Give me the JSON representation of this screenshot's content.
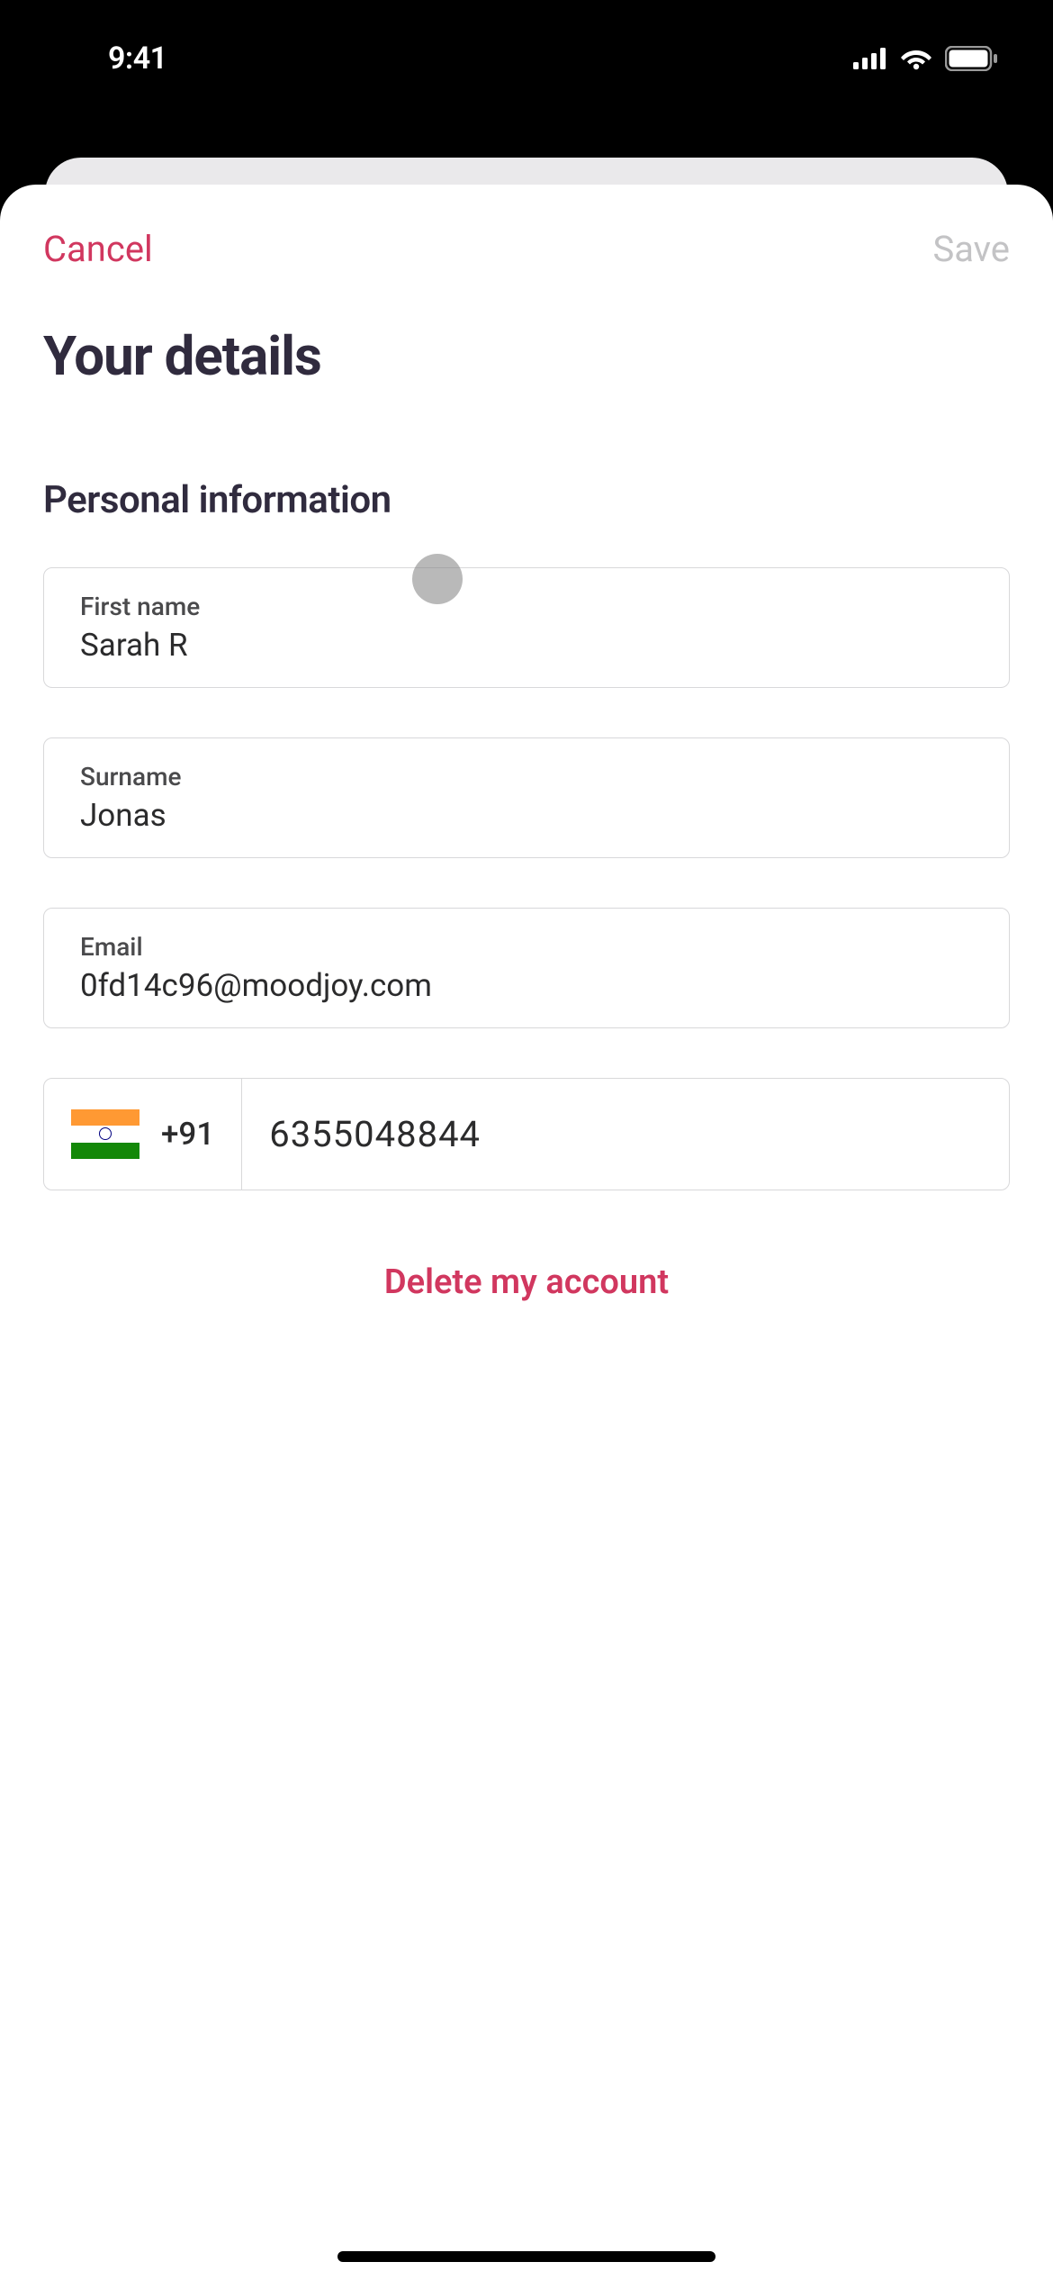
{
  "status_bar": {
    "time": "9:41"
  },
  "header": {
    "cancel_label": "Cancel",
    "save_label": "Save"
  },
  "page": {
    "title": "Your details"
  },
  "section": {
    "personal_info_title": "Personal information"
  },
  "fields": {
    "first_name": {
      "label": "First name",
      "value": "Sarah R"
    },
    "surname": {
      "label": "Surname",
      "value": "Jonas"
    },
    "email": {
      "label": "Email",
      "value": "0fd14c96@moodjoy.com"
    },
    "phone": {
      "country_code": "+91",
      "number": "6355048844"
    }
  },
  "actions": {
    "delete_account_label": "Delete my account"
  }
}
